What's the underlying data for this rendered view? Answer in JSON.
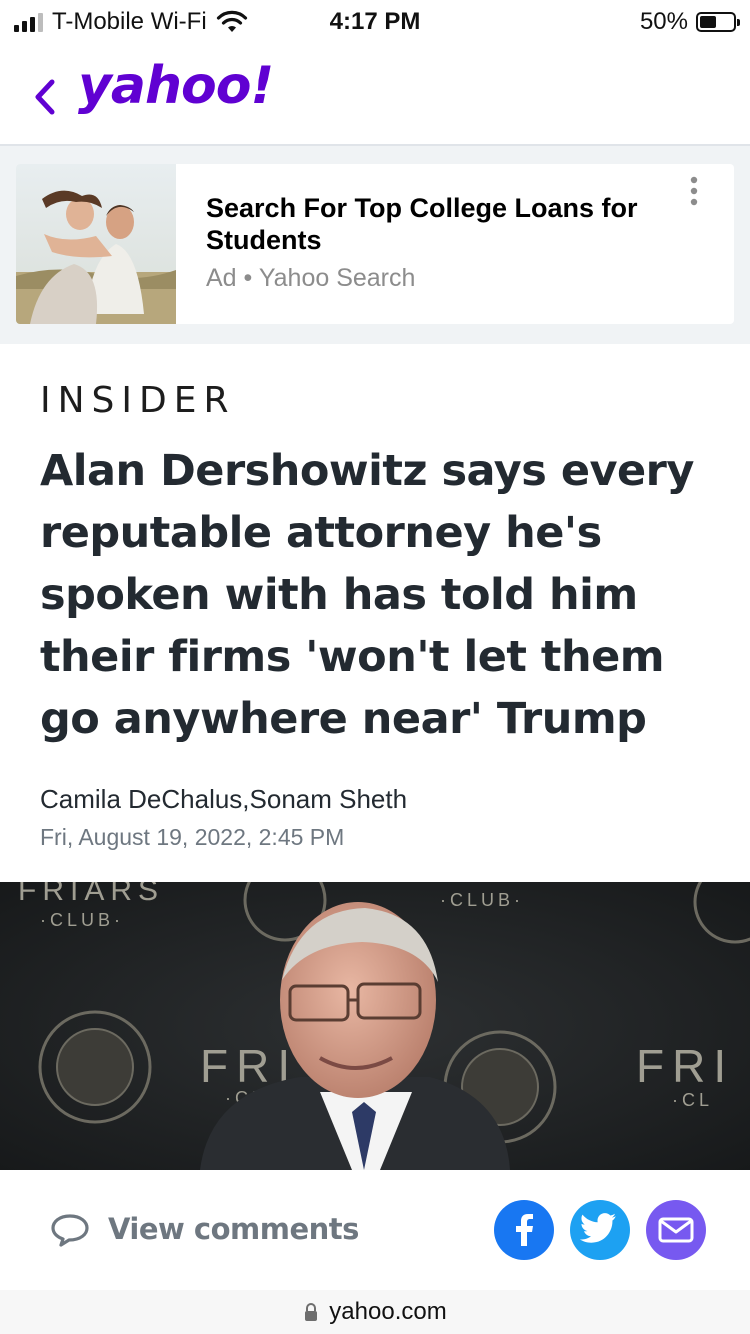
{
  "status_bar": {
    "carrier": "T-Mobile Wi-Fi",
    "time": "4:17 PM",
    "battery_percent": "50%",
    "signal_bars_filled": 3,
    "signal_bars_total": 4,
    "battery_level": 0.5
  },
  "nav": {
    "back_icon": "chevron-left-icon",
    "logo": "yahoo!",
    "brand_color": "#6001d2"
  },
  "ad": {
    "title": "Search For Top College Loans for Students",
    "label": "Ad",
    "separator": "•",
    "source": "Yahoo Search",
    "more_icon": "more-vertical-icon"
  },
  "article": {
    "publisher": "INSIDER",
    "headline": "Alan Dershowitz says every reputable attorney he's spoken with has told him their firms 'won't let them go anywhere near' Trump",
    "authors": "Camila DeChalus,Sonam Sheth",
    "date": "Fri, August 19, 2022, 2:45 PM"
  },
  "photo_backdrop_text": {
    "club": "·CLUB·",
    "friars": "FRIARS",
    "fri": "FRI",
    "cl": "·CL"
  },
  "actions": {
    "view_comments": "View comments",
    "comment_icon": "speech-bubble-icon",
    "share_facebook_icon": "facebook-icon",
    "share_twitter_icon": "twitter-icon",
    "share_mail_icon": "mail-icon",
    "facebook_color": "#1877f2",
    "twitter_color": "#1da1f2",
    "mail_color": "#7759f0"
  },
  "browser": {
    "url": "yahoo.com",
    "lock_icon": "lock-icon"
  }
}
